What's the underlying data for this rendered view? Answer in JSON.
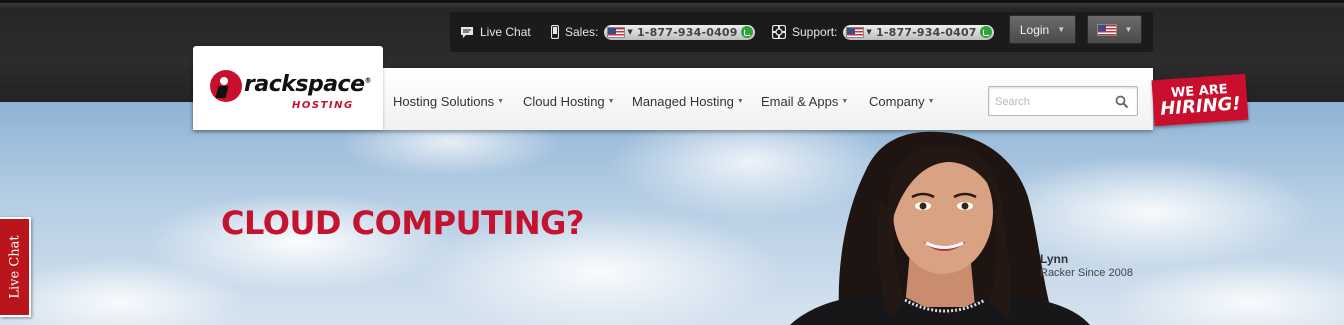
{
  "utility": {
    "live_chat": "Live Chat",
    "sales_label": "Sales:",
    "sales_phone": "1-877-934-0409",
    "support_label": "Support:",
    "support_phone": "1-877-934-0407",
    "login": "Login"
  },
  "logo": {
    "word": "rackspace",
    "sub": "HOSTING",
    "registered": "®"
  },
  "nav": {
    "items": [
      {
        "label": "Hosting Solutions"
      },
      {
        "label": "Cloud Hosting"
      },
      {
        "label": "Managed Hosting"
      },
      {
        "label": "Email & Apps"
      },
      {
        "label": "Company"
      }
    ]
  },
  "search": {
    "placeholder": "Search"
  },
  "hiring": {
    "line1": "WE ARE",
    "line2": "HIRING!"
  },
  "hero": {
    "headline": "CLOUD COMPUTING?",
    "person_name": "Lynn",
    "person_caption": "Racker Since 2008"
  },
  "side_tab": {
    "label": "Live Chat"
  },
  "colors": {
    "brand_red": "#c8102e",
    "topbar": "#262626",
    "call_green": "#2ea43a"
  },
  "icons": {
    "chat": "speech-bubble-icon",
    "phone": "mobile-phone-icon",
    "support": "lifebuoy-icon",
    "search": "magnifier-icon",
    "flag": "us-flag-icon"
  }
}
